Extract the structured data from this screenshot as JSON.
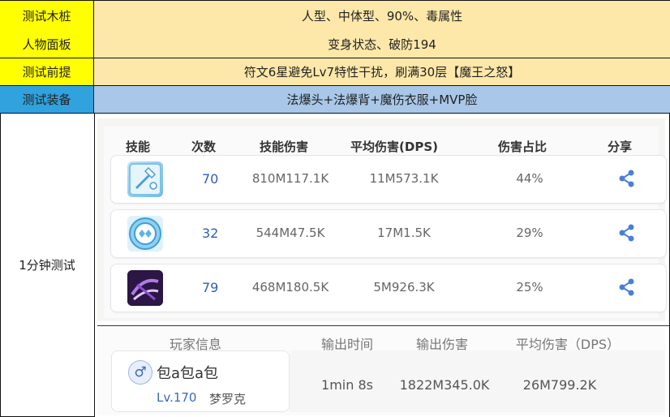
{
  "rows": {
    "dummy": {
      "label": "测试木桩",
      "value": "人型、中体型、90%、毒属性"
    },
    "panel": {
      "label": "人物面板",
      "value": "变身状态、破防194"
    },
    "premise": {
      "label": "测试前提",
      "value": "符文6星避免Lv7特性干扰，刷满30层【魔王之怒】"
    },
    "equip": {
      "label": "测试装备",
      "value": "法爆头+法爆背+魔伤衣服+MVP脸"
    },
    "test": {
      "label": "1分钟测试"
    }
  },
  "skill_table": {
    "headers": [
      "技能",
      "次数",
      "技能伤害",
      "平均伤害(DPS)",
      "伤害占比",
      "分享"
    ],
    "rows": [
      {
        "icon": "sword-skill-icon",
        "count": "70",
        "damage": "810M117.1K",
        "avg": "11M573.1K",
        "ratio": "44%"
      },
      {
        "icon": "frost-orb-skill-icon",
        "count": "32",
        "damage": "544M47.5K",
        "avg": "17M1.5K",
        "ratio": "29%"
      },
      {
        "icon": "dark-vortex-skill-icon",
        "count": "79",
        "damage": "468M180.5K",
        "avg": "5M926.3K",
        "ratio": "25%"
      }
    ]
  },
  "player": {
    "headers": [
      "玩家信息",
      "输出时间",
      "输出伤害",
      "平均伤害（DPS）"
    ],
    "gender_symbol": "♂",
    "name": "包a包a包",
    "level": "Lv.170",
    "class": "梦罗克",
    "time": "1min 8s",
    "damage": "1822M345.0K",
    "avg": "26M799.2K"
  },
  "colors": {
    "label_yellow": "#ffff00",
    "value_peach": "#fde8a9",
    "label_blue": "#30a2de",
    "value_blue": "#a9c7e8",
    "count_blue": "#2d5fb3",
    "share_blue": "#4a7fd6"
  }
}
